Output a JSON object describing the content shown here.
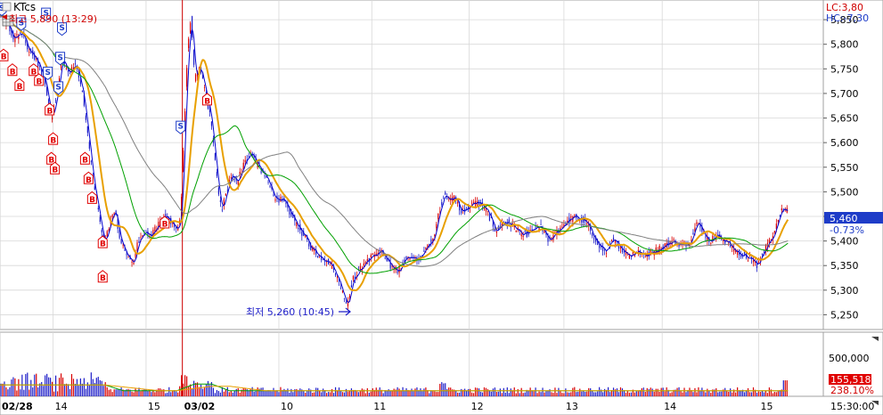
{
  "header": {
    "symbol": "KTcs",
    "high_note": "최고 5,890 (13:29)",
    "low_note": "최저 5,260 (10:45)",
    "lc_label": "LC:3,80",
    "hc_label": "HC:-7,30"
  },
  "colors": {
    "background": "#ffffff",
    "grid": "#d8d8d8",
    "up": "#d80000",
    "down": "#1e1ec8",
    "ma_short": "#e8a000",
    "ma_mid": "#00a000",
    "ma_long": "#808080",
    "ma_fast": "#0000d0",
    "marker_red": "#e00000",
    "marker_blue": "#1e3cc8"
  },
  "chart_data": {
    "type": "candlestick",
    "price_axis": {
      "ticks": [
        "5,850",
        "5,800",
        "5,750",
        "5,700",
        "5,650",
        "5,600",
        "5,550",
        "5,500",
        "5,450",
        "5,400",
        "5,350",
        "5,300",
        "5,250"
      ],
      "ylim": [
        5220,
        5890
      ]
    },
    "current_price": {
      "value": 5460,
      "label": "5,460",
      "change": "-0.73%"
    },
    "x_axis": {
      "labels": [
        "02/28",
        "14",
        "15",
        "03/02",
        "10",
        "11",
        "12",
        "13",
        "14",
        "15",
        "15:30:00"
      ],
      "index": [
        0,
        60,
        165,
        206,
        315,
        420,
        530,
        637,
        748,
        857,
        930
      ]
    },
    "session_divider_index": 206,
    "price_path": [
      [
        0,
        5860
      ],
      [
        8,
        5840
      ],
      [
        16,
        5810
      ],
      [
        24,
        5825
      ],
      [
        32,
        5790
      ],
      [
        40,
        5770
      ],
      [
        50,
        5730
      ],
      [
        58,
        5650
      ],
      [
        64,
        5700
      ],
      [
        70,
        5770
      ],
      [
        78,
        5740
      ],
      [
        86,
        5760
      ],
      [
        94,
        5690
      ],
      [
        100,
        5600
      ],
      [
        106,
        5510
      ],
      [
        112,
        5450
      ],
      [
        118,
        5390
      ],
      [
        124,
        5440
      ],
      [
        130,
        5460
      ],
      [
        136,
        5400
      ],
      [
        144,
        5370
      ],
      [
        150,
        5350
      ],
      [
        156,
        5400
      ],
      [
        162,
        5420
      ],
      [
        170,
        5410
      ],
      [
        178,
        5430
      ],
      [
        186,
        5450
      ],
      [
        194,
        5440
      ],
      [
        200,
        5420
      ],
      [
        204,
        5450
      ],
      [
        208,
        5620
      ],
      [
        212,
        5800
      ],
      [
        216,
        5850
      ],
      [
        220,
        5730
      ],
      [
        226,
        5750
      ],
      [
        232,
        5700
      ],
      [
        238,
        5650
      ],
      [
        244,
        5540
      ],
      [
        250,
        5460
      ],
      [
        256,
        5500
      ],
      [
        262,
        5540
      ],
      [
        268,
        5520
      ],
      [
        276,
        5560
      ],
      [
        284,
        5580
      ],
      [
        292,
        5550
      ],
      [
        300,
        5530
      ],
      [
        310,
        5490
      ],
      [
        320,
        5480
      ],
      [
        330,
        5450
      ],
      [
        340,
        5420
      ],
      [
        350,
        5390
      ],
      [
        360,
        5370
      ],
      [
        370,
        5360
      ],
      [
        378,
        5340
      ],
      [
        386,
        5300
      ],
      [
        392,
        5270
      ],
      [
        398,
        5320
      ],
      [
        406,
        5340
      ],
      [
        414,
        5360
      ],
      [
        422,
        5370
      ],
      [
        430,
        5380
      ],
      [
        440,
        5350
      ],
      [
        450,
        5340
      ],
      [
        460,
        5370
      ],
      [
        470,
        5360
      ],
      [
        480,
        5380
      ],
      [
        490,
        5410
      ],
      [
        496,
        5460
      ],
      [
        502,
        5500
      ],
      [
        508,
        5480
      ],
      [
        514,
        5490
      ],
      [
        520,
        5460
      ],
      [
        530,
        5470
      ],
      [
        540,
        5480
      ],
      [
        550,
        5460
      ],
      [
        560,
        5420
      ],
      [
        570,
        5440
      ],
      [
        580,
        5430
      ],
      [
        590,
        5410
      ],
      [
        600,
        5420
      ],
      [
        610,
        5430
      ],
      [
        620,
        5400
      ],
      [
        630,
        5420
      ],
      [
        640,
        5440
      ],
      [
        650,
        5450
      ],
      [
        660,
        5440
      ],
      [
        668,
        5420
      ],
      [
        676,
        5390
      ],
      [
        684,
        5380
      ],
      [
        692,
        5400
      ],
      [
        700,
        5390
      ],
      [
        710,
        5370
      ],
      [
        720,
        5380
      ],
      [
        730,
        5370
      ],
      [
        740,
        5380
      ],
      [
        750,
        5390
      ],
      [
        760,
        5400
      ],
      [
        770,
        5390
      ],
      [
        780,
        5400
      ],
      [
        786,
        5440
      ],
      [
        794,
        5420
      ],
      [
        800,
        5400
      ],
      [
        810,
        5410
      ],
      [
        820,
        5400
      ],
      [
        830,
        5380
      ],
      [
        840,
        5370
      ],
      [
        850,
        5360
      ],
      [
        856,
        5350
      ],
      [
        862,
        5380
      ],
      [
        870,
        5400
      ],
      [
        878,
        5440
      ],
      [
        884,
        5470
      ],
      [
        890,
        5460
      ]
    ],
    "markers": [
      {
        "type": "S",
        "i": 2,
        "p": 5860
      },
      {
        "type": "S",
        "i": 24,
        "p": 5830
      },
      {
        "type": "S",
        "i": 52,
        "p": 5850
      },
      {
        "type": "S",
        "i": 70,
        "p": 5820
      },
      {
        "type": "S",
        "i": 68,
        "p": 5760
      },
      {
        "type": "S",
        "i": 54,
        "p": 5730
      },
      {
        "type": "S",
        "i": 66,
        "p": 5700
      },
      {
        "type": "S",
        "i": 204,
        "p": 5620
      },
      {
        "type": "B",
        "i": 4,
        "p": 5790
      },
      {
        "type": "B",
        "i": 14,
        "p": 5760
      },
      {
        "type": "B",
        "i": 22,
        "p": 5730
      },
      {
        "type": "B",
        "i": 38,
        "p": 5760
      },
      {
        "type": "B",
        "i": 44,
        "p": 5740
      },
      {
        "type": "B",
        "i": 56,
        "p": 5680
      },
      {
        "type": "B",
        "i": 60,
        "p": 5620
      },
      {
        "type": "B",
        "i": 58,
        "p": 5580
      },
      {
        "type": "B",
        "i": 62,
        "p": 5560
      },
      {
        "type": "B",
        "i": 96,
        "p": 5580
      },
      {
        "type": "B",
        "i": 100,
        "p": 5540
      },
      {
        "type": "B",
        "i": 104,
        "p": 5500
      },
      {
        "type": "B",
        "i": 116,
        "p": 5410
      },
      {
        "type": "B",
        "i": 116,
        "p": 5340
      },
      {
        "type": "B",
        "i": 186,
        "p": 5450
      },
      {
        "type": "B",
        "i": 234,
        "p": 5700
      }
    ],
    "volume_axis": {
      "ticks": [
        "500,000"
      ],
      "max": 1000000
    },
    "volume_label": {
      "value": "155,518",
      "ratio": "238.10%"
    }
  }
}
